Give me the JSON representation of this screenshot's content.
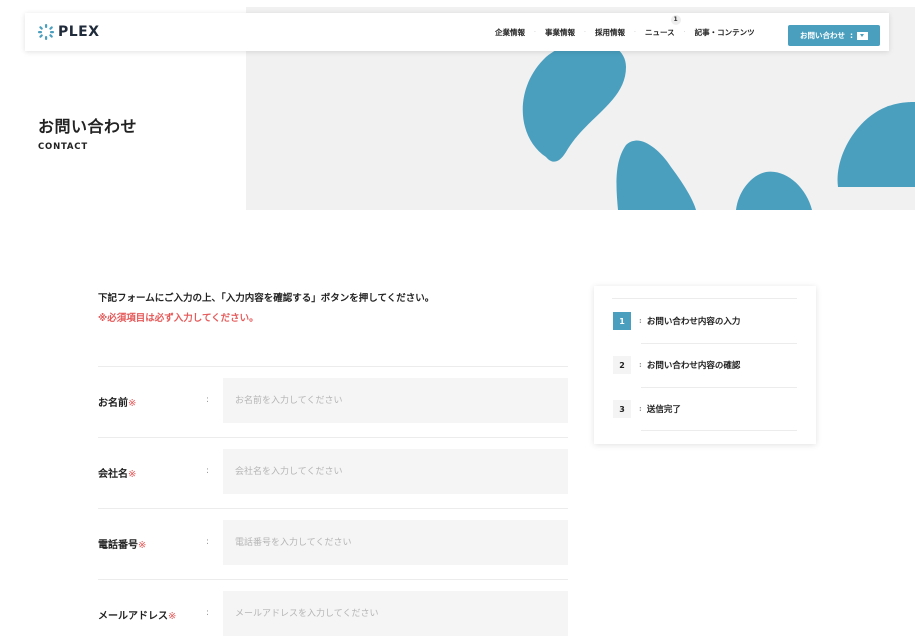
{
  "brand": {
    "name": "PLEX",
    "accent": "#4a9fbf",
    "required_color": "#e65a5a"
  },
  "nav": {
    "items": [
      {
        "label": "企業情報"
      },
      {
        "label": "事業情報"
      },
      {
        "label": "採用情報"
      },
      {
        "label": "ニュース",
        "badge": "1"
      },
      {
        "label": "記事・コンテンツ"
      }
    ],
    "contact_button": {
      "label": "お問い合わせ",
      "colon": ":",
      "icon": "mail-icon"
    }
  },
  "hero": {
    "title": "お問い合わせ",
    "subtitle": "CONTACT"
  },
  "intro": {
    "text": "下記フォームにご入力の上、「入力内容を確認する」ボタンを押してください。",
    "required_note": "※必須項目は必ず入力してください。"
  },
  "form": {
    "colon": ":",
    "fields": [
      {
        "label": "お名前",
        "required_mark": "※",
        "placeholder": "お名前を入力してください"
      },
      {
        "label": "会社名",
        "required_mark": "※",
        "placeholder": "会社名を入力してください"
      },
      {
        "label": "電話番号",
        "required_mark": "※",
        "placeholder": "電話番号を入力してください"
      },
      {
        "label": "メールアドレス",
        "required_mark": "※",
        "placeholder": "メールアドレスを入力してください"
      }
    ]
  },
  "steps": {
    "colon": ":",
    "items": [
      {
        "num": "1",
        "label": "お問い合わせ内容の入力",
        "active": true
      },
      {
        "num": "2",
        "label": "お問い合わせ内容の確認",
        "active": false
      },
      {
        "num": "3",
        "label": "送信完了",
        "active": false
      }
    ]
  }
}
